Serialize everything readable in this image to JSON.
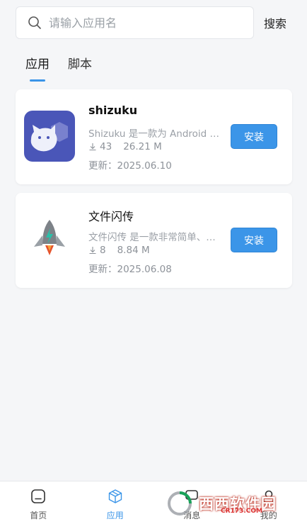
{
  "search": {
    "placeholder": "请输入应用名",
    "value": "",
    "button_label": "搜索"
  },
  "tabs": [
    {
      "label": "应用",
      "active": true
    },
    {
      "label": "脚本",
      "active": false
    }
  ],
  "apps": [
    {
      "name": "shizuku",
      "description": "Shizuku 是一款为 Android …",
      "downloads": "43",
      "size": "26.21 M",
      "updated": "更新：2025.06.10",
      "install_label": "安装",
      "icon": "shizuku-icon"
    },
    {
      "name": "文件闪传",
      "description": "文件闪传 是一款非常简单、…",
      "downloads": "8",
      "size": "8.84 M",
      "updated": "更新：2025.06.08",
      "install_label": "安装",
      "icon": "rocket-icon"
    }
  ],
  "bottom_nav": [
    {
      "label": "首页",
      "icon": "home-icon",
      "active": false
    },
    {
      "label": "应用",
      "icon": "box-icon",
      "active": true
    },
    {
      "label": "消息",
      "icon": "message-icon",
      "active": false
    },
    {
      "label": "我的",
      "icon": "user-icon",
      "active": false
    }
  ],
  "watermark": {
    "text": "西西软件园",
    "sub": "CR173.COM"
  },
  "colors": {
    "accent": "#3b95e8",
    "background": "#f5f6f8"
  }
}
